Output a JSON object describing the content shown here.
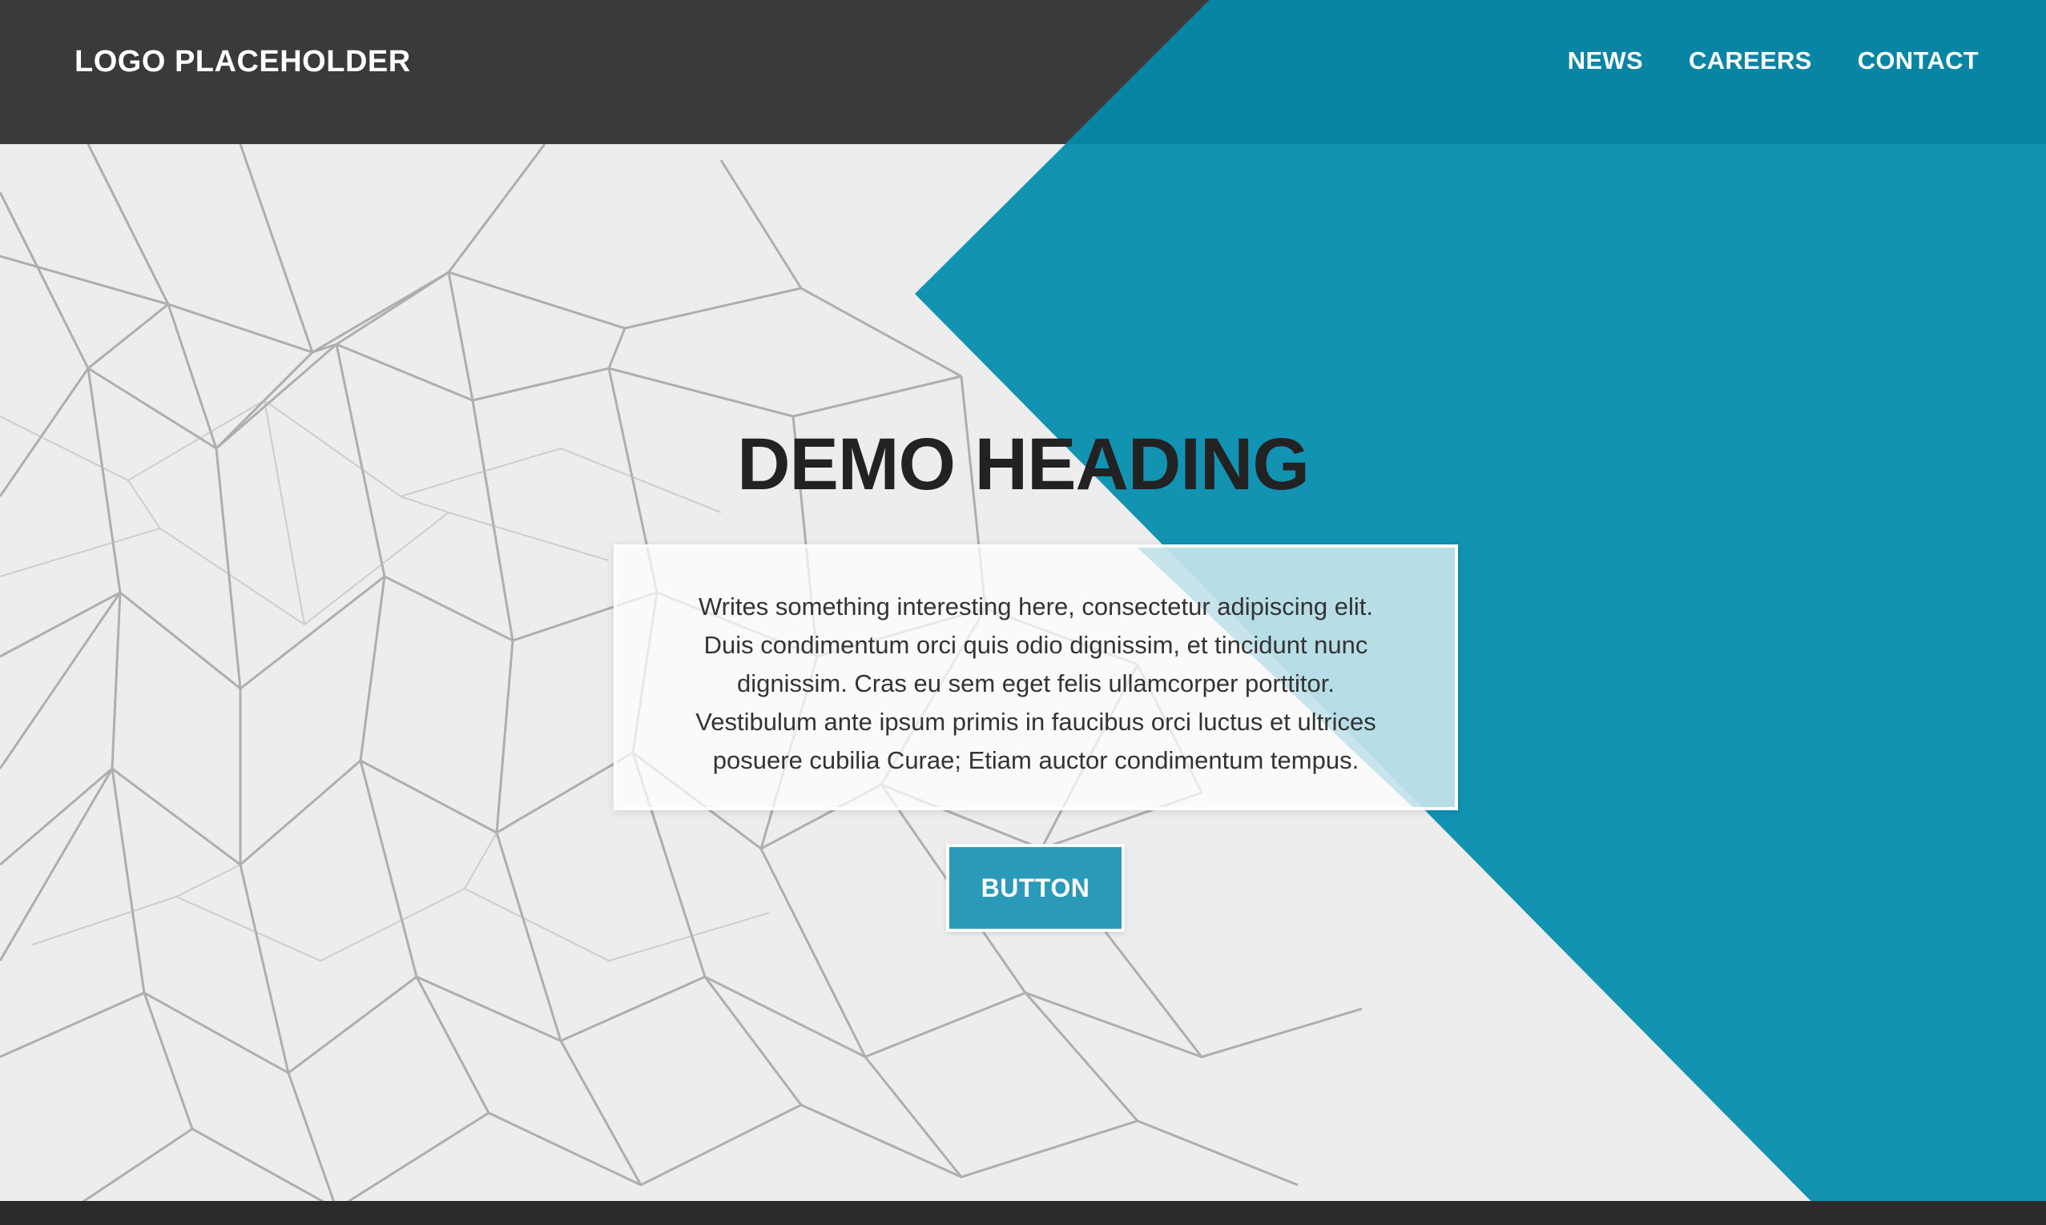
{
  "header": {
    "logo": "LOGO PLACEHOLDER",
    "nav": [
      {
        "label": "NEWS"
      },
      {
        "label": "CAREERS"
      },
      {
        "label": "CONTACT"
      }
    ]
  },
  "hero": {
    "heading": "DEMO HEADING",
    "body_lines": [
      "Writes something interesting here, consectetur adipiscing elit.",
      "Duis condimentum orci quis odio dignissim, et tincidunt nunc",
      "dignissim. Cras eu sem eget felis ullamcorper porttitor.",
      "Vestibulum ante ipsum primis in faucibus orci luctus et ultrices",
      "posuere cubilia Curae; Etiam auctor condimentum tempus."
    ],
    "button_label": "BUTTON"
  },
  "colors": {
    "header_dark": "#3a3a3a",
    "accent_blue": "#0a8fb0",
    "button_blue": "#2a9ab8",
    "heading": "#222222",
    "footer": "#2a2a2a"
  }
}
